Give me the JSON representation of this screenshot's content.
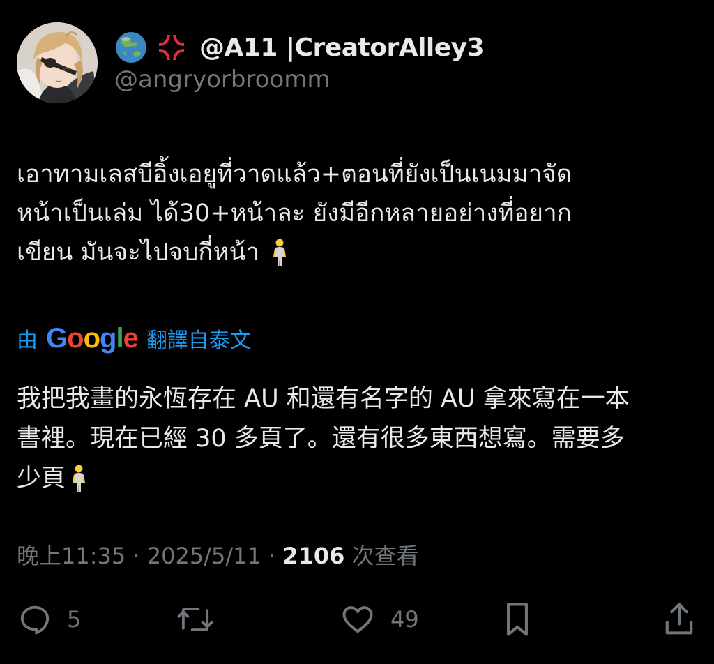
{
  "author": {
    "avatar_icon": "anime-character-avatar",
    "emoji_1": "globe-asia-australia-emoji",
    "emoji_2": "anger-symbol-emoji",
    "display_name": "@A11 |CreatorAlley3",
    "handle": "@angryorbroomm"
  },
  "tweet": {
    "lines": [
      "เอาทามเลสบีอิ้งเอยูที่วาดแล้ว+ตอนที่ยังเป็นเนมมาจัด",
      "หน้าเป็นเล่ม ได้30+หน้าละ ยังมีอีกหลายอย่างที่อยาก",
      "เขียน มันจะไปจบกี่หน้า"
    ],
    "trailing_emoji": "person-standing-emoji"
  },
  "translation": {
    "prefix": "由",
    "provider": "Google",
    "suffix": "翻譯自泰文",
    "lines": [
      "我把我畫的永恆存在 AU 和還有名字的 AU 拿來寫在一本",
      "書裡。現在已經 30 多頁了。還有很多東西想寫。需要多",
      "少頁"
    ]
  },
  "meta": {
    "time": "晚上11:35",
    "separator": " · ",
    "date": "2025/5/11",
    "views_count": "2106",
    "views_label": " 次查看"
  },
  "actions": {
    "reply_count": "5",
    "like_count": "49"
  },
  "colors": {
    "background": "#000000",
    "text": "#e7e9ea",
    "secondary": "#71767b",
    "link": "#1d9bf0"
  }
}
